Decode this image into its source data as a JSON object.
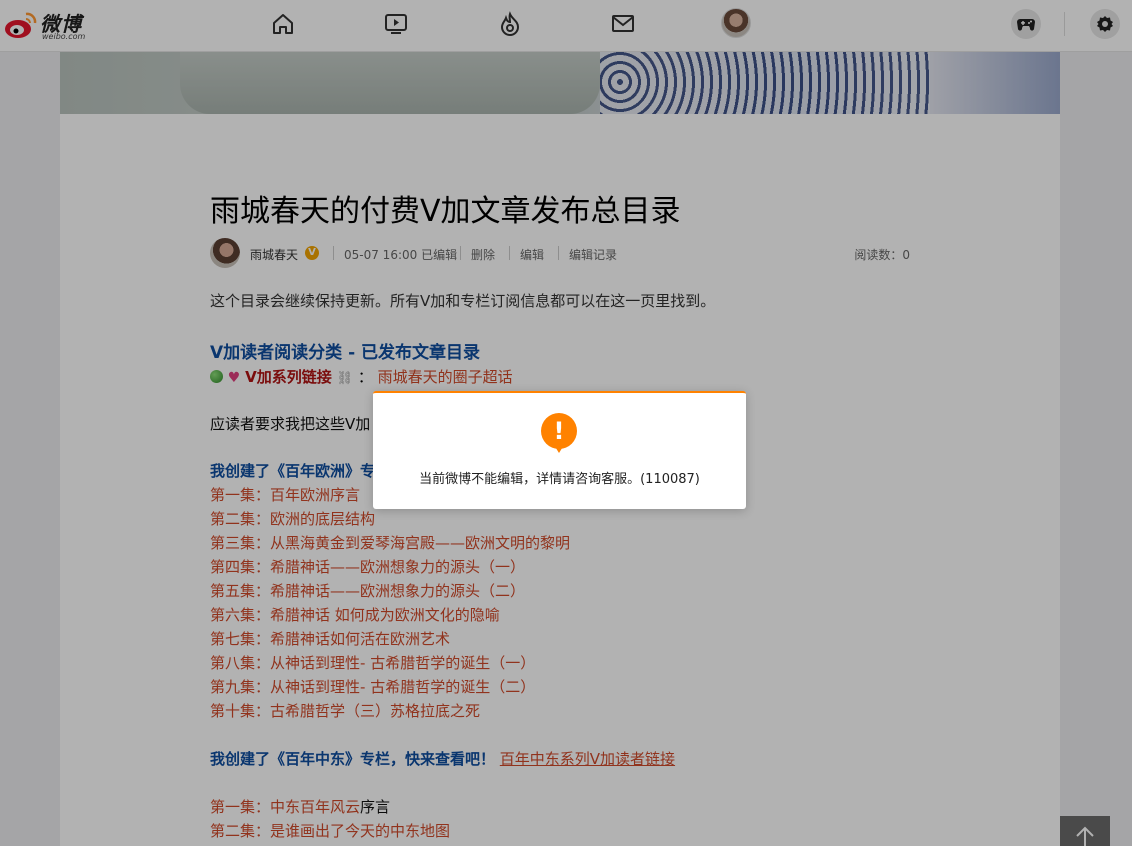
{
  "nav": {
    "logo_text": "微博",
    "logo_sub": "weibo.com",
    "icons": [
      "home-icon",
      "video-icon",
      "hot-icon",
      "mail-icon"
    ]
  },
  "article": {
    "title": "雨城春天的付费V加文章发布总目录",
    "author": "雨城春天",
    "badge": "V",
    "time_edit": "05-07 16:00 已编辑",
    "action_delete": "删除",
    "action_edit": "编辑",
    "action_history": "编辑记录",
    "reads": "阅读数：0",
    "intro": "这个目录会继续保持更新。所有V加和专栏订阅信息都可以在这一页里找到。",
    "section1_heading": "V加读者阅读分类 - 已发布文章目录",
    "vlink_label": "V加系列链接",
    "vlink_colon": "：",
    "vlink_text": "雨城春天的圈子超话",
    "request_line": "应读者要求我把这些V加",
    "europe_heading": "我创建了《百年欧洲》专",
    "europe_eps": [
      {
        "label": "第一集：",
        "title": "百年欧洲序言"
      },
      {
        "label": "第二集：",
        "title": "欧洲的底层结构"
      },
      {
        "label": "第三集：",
        "title": "从黑海黄金到爱琴海宫殿——欧洲文明的黎明"
      },
      {
        "label": "第四集：",
        "title": "希腊神话——欧洲想象力的源头（一）"
      },
      {
        "label": "第五集：",
        "title": "希腊神话——欧洲想象力的源头（二）"
      },
      {
        "label": "第六集：",
        "title": "希腊神话 如何成为欧洲文化的隐喻"
      },
      {
        "label": "第七集：",
        "title": "希腊神话如何活在欧洲艺术"
      },
      {
        "label": "第八集：",
        "title": "从神话到理性- 古希腊哲学的诞生（一）"
      },
      {
        "label": "第九集：",
        "title": "从神话到理性- 古希腊哲学的诞生（二）"
      },
      {
        "label": "第十集：",
        "title": "古希腊哲学（三）苏格拉底之死"
      }
    ],
    "mideast_heading": "我创建了《百年中东》专栏，快来查看吧！",
    "mideast_link": "百年中东系列V加读者链接",
    "mideast_eps": [
      {
        "label": "第一集：",
        "title": "中东百年风云",
        "suffix": "序言"
      },
      {
        "label": "第二集：",
        "title": "是谁画出了今天的中东地图",
        "suffix": ""
      }
    ]
  },
  "modal": {
    "icon": "!",
    "message": "当前微博不能编辑，详情请咨询客服。(110087)"
  }
}
